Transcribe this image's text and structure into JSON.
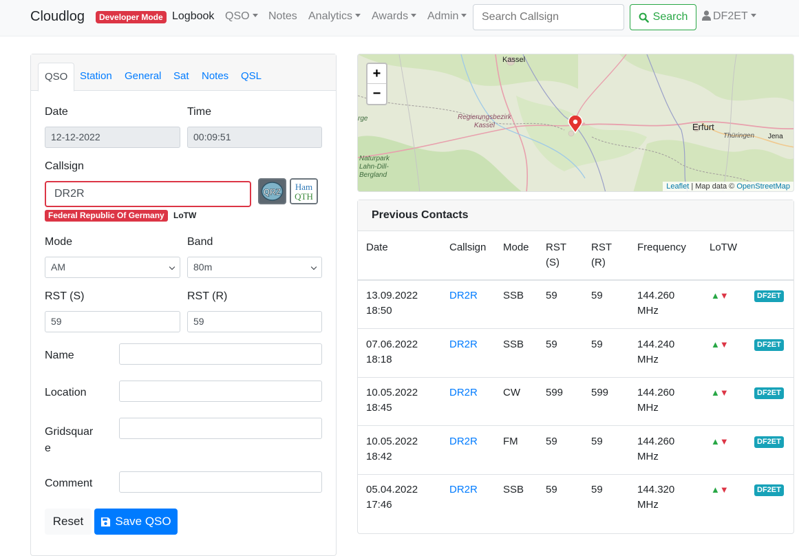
{
  "navbar": {
    "brand": "Cloudlog",
    "dev_badge": "Developer Mode",
    "items": [
      {
        "label": "Logbook"
      },
      {
        "label": "QSO"
      },
      {
        "label": "Notes"
      },
      {
        "label": "Analytics"
      },
      {
        "label": "Awards"
      },
      {
        "label": "Admin"
      }
    ],
    "search_placeholder": "Search Callsign",
    "search_button": "Search",
    "user": "DF2ET"
  },
  "tabs": [
    "QSO",
    "Station",
    "General",
    "Sat",
    "Notes",
    "QSL"
  ],
  "form": {
    "date_label": "Date",
    "date_value": "12-12-2022",
    "time_label": "Time",
    "time_value": "00:09:51",
    "callsign_label": "Callsign",
    "callsign_value": "DR2R",
    "country_badge": "Federal Republic Of Germany",
    "lotw_badge": "LoTW",
    "qrz_icon_text": "QRZ",
    "hamqth_icon_text": [
      "Ham",
      "QTH"
    ],
    "mode_label": "Mode",
    "mode_value": "AM",
    "band_label": "Band",
    "band_value": "80m",
    "rst_s_label": "RST (S)",
    "rst_s_value": "59",
    "rst_r_label": "RST (R)",
    "rst_r_value": "59",
    "name_label": "Name",
    "location_label": "Location",
    "gridsquare_label": [
      "Gridsquar",
      "e"
    ],
    "comment_label": "Comment",
    "reset_button": "Reset",
    "save_button": "Save QSO"
  },
  "map": {
    "labels": {
      "kassel_top": "Kassel",
      "regbez": [
        "Regierungsbezirk",
        "Kassel"
      ],
      "erfurt": "Erfurt",
      "thueringen": "Thüringen",
      "jena": "Jena",
      "naturpark": [
        "Naturpark",
        "Lahn-Dill-",
        "Bergland"
      ],
      "edge": "rge"
    },
    "zoom_in": "+",
    "zoom_out": "−",
    "attribution_leaflet": "Leaflet",
    "attribution_text": " | Map data © ",
    "attribution_osm": "OpenStreetMap"
  },
  "previous_contacts": {
    "title": "Previous Contacts",
    "headers": {
      "date": "Date",
      "callsign": "Callsign",
      "mode": "Mode",
      "rst_s": [
        "RST",
        "(S)"
      ],
      "rst_r": [
        "RST",
        "(R)"
      ],
      "frequency": "Frequency",
      "lotw": "LoTW"
    },
    "rows": [
      {
        "date": "13.09.2022",
        "time": "18:50",
        "callsign": "DR2R",
        "mode": "SSB",
        "rst_s": "59",
        "rst_r": "59",
        "freq": "144.260",
        "unit": "MHz",
        "op": "DF2ET"
      },
      {
        "date": "07.06.2022",
        "time": "18:18",
        "callsign": "DR2R",
        "mode": "SSB",
        "rst_s": "59",
        "rst_r": "59",
        "freq": "144.240",
        "unit": "MHz",
        "op": "DF2ET"
      },
      {
        "date": "10.05.2022",
        "time": "18:45",
        "callsign": "DR2R",
        "mode": "CW",
        "rst_s": "599",
        "rst_r": "599",
        "freq": "144.260",
        "unit": "MHz",
        "op": "DF2ET"
      },
      {
        "date": "10.05.2022",
        "time": "18:42",
        "callsign": "DR2R",
        "mode": "FM",
        "rst_s": "59",
        "rst_r": "59",
        "freq": "144.260",
        "unit": "MHz",
        "op": "DF2ET"
      },
      {
        "date": "05.04.2022",
        "time": "17:46",
        "callsign": "DR2R",
        "mode": "SSB",
        "rst_s": "59",
        "rst_r": "59",
        "freq": "144.320",
        "unit": "MHz",
        "op": "DF2ET"
      }
    ],
    "lotw_up": "▲",
    "lotw_down": "▼"
  },
  "colors": {
    "primary": "#007bff",
    "danger": "#dc3545",
    "success": "#28a745",
    "info": "#17a2b8"
  }
}
